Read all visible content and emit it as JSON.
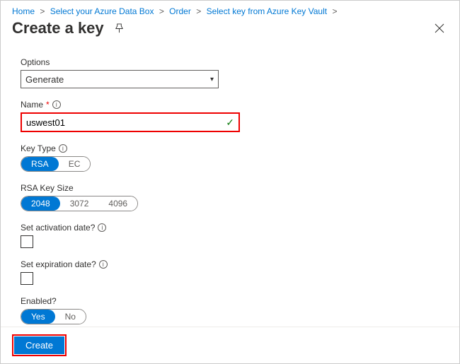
{
  "breadcrumb": {
    "items": [
      {
        "label": "Home"
      },
      {
        "label": "Select your Azure Data Box"
      },
      {
        "label": "Order"
      },
      {
        "label": "Select key from Azure Key Vault"
      }
    ]
  },
  "header": {
    "title": "Create a key"
  },
  "form": {
    "options": {
      "label": "Options",
      "value": "Generate"
    },
    "name": {
      "label": "Name",
      "value": "uswest01"
    },
    "key_type": {
      "label": "Key Type",
      "opts": [
        "RSA",
        "EC"
      ],
      "selected": "RSA"
    },
    "rsa_size": {
      "label": "RSA Key Size",
      "opts": [
        "2048",
        "3072",
        "4096"
      ],
      "selected": "2048"
    },
    "activation": {
      "label": "Set activation date?",
      "checked": false
    },
    "expiration": {
      "label": "Set expiration date?",
      "checked": false
    },
    "enabled": {
      "label": "Enabled?",
      "opts": [
        "Yes",
        "No"
      ],
      "selected": "Yes"
    }
  },
  "footer": {
    "create": "Create"
  }
}
